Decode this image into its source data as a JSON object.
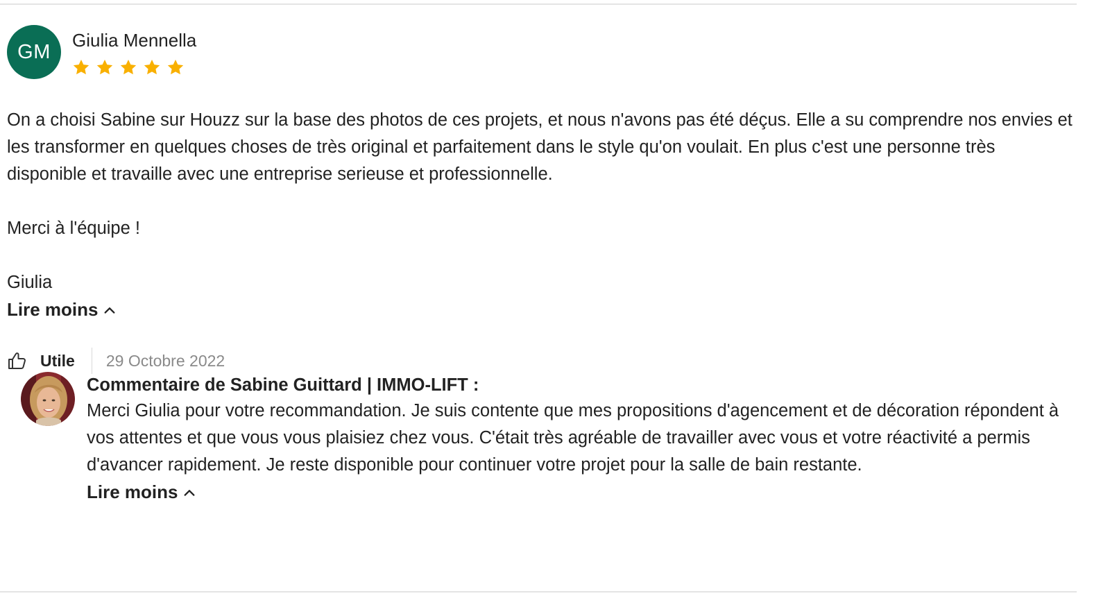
{
  "review": {
    "initials": "GM",
    "avatar_color": "#0a6e55",
    "reviewer_name": "Giulia Mennella",
    "rating": 5,
    "rating_max": 5,
    "star_color": "#f9b000",
    "paragraphs": [
      "On a choisi Sabine sur Houzz sur la base des photos de ces projets, et nous n'avons pas été déçus. Elle a su comprendre nos envies et les transformer en quelques choses de très original et parfaitement dans le style qu'on voulait. En plus c'est une personne très disponible et travaille avec une entreprise serieuse et professionnelle.",
      "Merci à l'équipe !",
      "Giulia"
    ],
    "read_less_label": "Lire moins",
    "helpful_label": "Utile",
    "date": "29 Octobre 2022"
  },
  "reply": {
    "title": "Commentaire de Sabine Guittard | IMMO-LIFT :",
    "text": "Merci Giulia pour votre recommandation. Je suis contente que mes propositions d'agencement et de décoration répondent à vos attentes et que vous vous plaisiez chez vous. C'était très agréable de travailler avec vous et votre réactivité a permis d'avancer rapidement. Je reste disponible pour continuer votre projet pour la salle de bain restante.",
    "read_less_label": "Lire moins"
  },
  "icons": {
    "star": "star-icon",
    "thumb": "thumbs-up-icon",
    "chevron": "chevron-up-icon"
  }
}
